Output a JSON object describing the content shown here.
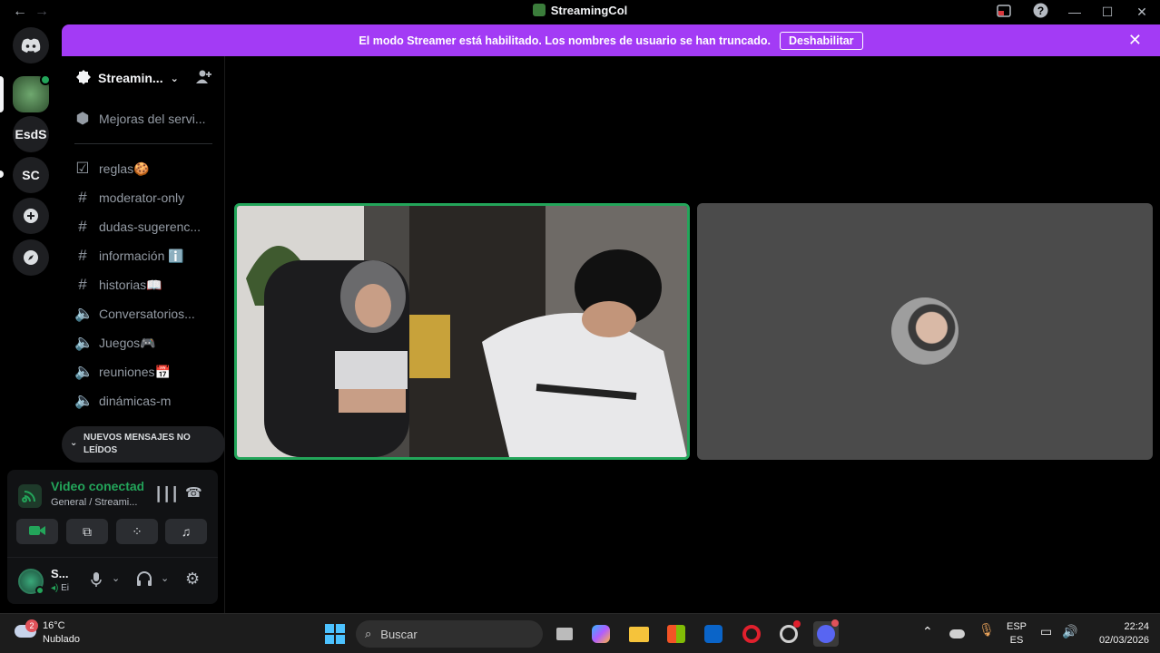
{
  "window": {
    "title": "StreamingCol",
    "back_icon": "←",
    "forward_icon": "→"
  },
  "rail": {
    "servers": [
      {
        "label": "EsdS"
      },
      {
        "label": "SC"
      }
    ]
  },
  "banner": {
    "text": "El modo Streamer está habilitado. Los nombres de usuario se han truncado.",
    "button": "Deshabilitar",
    "color": "#a33bf5"
  },
  "sidebar": {
    "server_name": "Streamin...",
    "boost": "Mejoras del servi...",
    "channels": [
      {
        "label": "reglas🍪",
        "icon": "rules-icon"
      },
      {
        "label": "moderator-only",
        "icon": "hash-icon"
      },
      {
        "label": "dudas-sugerenc...",
        "icon": "hash-icon"
      },
      {
        "label": "información ℹ️",
        "icon": "hash-icon"
      },
      {
        "label": "historias📖",
        "icon": "hash-icon"
      },
      {
        "label": "Conversatorios...",
        "icon": "speaker-icon"
      },
      {
        "label": "Juegos🎮",
        "icon": "speaker-icon"
      },
      {
        "label": "reuniones📅",
        "icon": "speaker-icon"
      },
      {
        "label": "dinámicas-m",
        "icon": "speaker-icon"
      }
    ],
    "unread_pill": "NUEVOS MENSAJES NO LEÍDOS"
  },
  "voice": {
    "status": "Video conectado",
    "channel": "General / Streami...",
    "user_name": "S...",
    "user_status": "Ei",
    "accent": "#23a55a"
  },
  "taskbar": {
    "weather_temp": "16°C",
    "weather_desc": "Nublado",
    "weather_badge": "2",
    "search_placeholder": "Buscar",
    "lang_top": "ESP",
    "lang_bottom": "ES",
    "time": "22:24",
    "date": "02/03/2026"
  }
}
